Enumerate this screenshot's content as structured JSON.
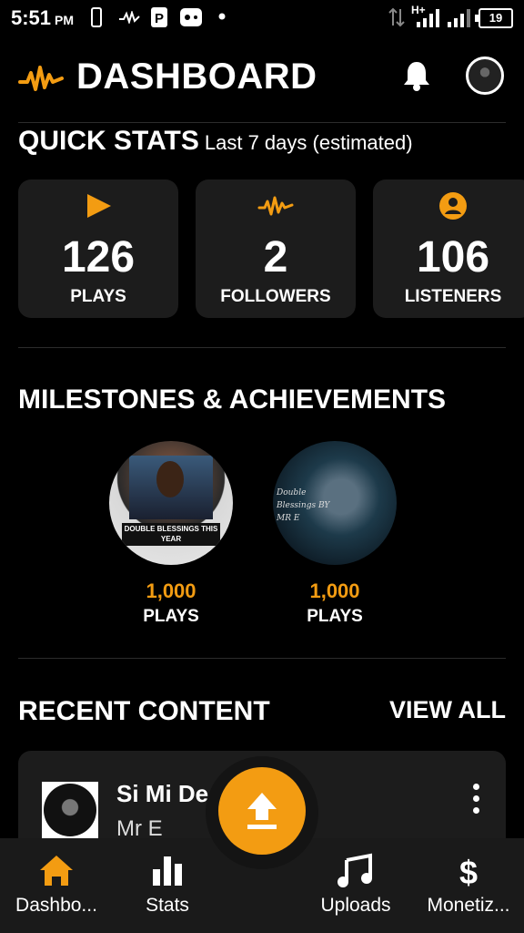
{
  "status_bar": {
    "time": "5:51",
    "ampm": "PM",
    "network": "H+",
    "battery": "19"
  },
  "header": {
    "title": "DASHBOARD"
  },
  "quick_stats": {
    "title": "QUICK STATS",
    "subtitle": "Last 7 days (estimated)",
    "cards": [
      {
        "value": "126",
        "label": "PLAYS",
        "icon": "play-icon"
      },
      {
        "value": "2",
        "label": "FOLLOWERS",
        "icon": "audiomack-logo-icon"
      },
      {
        "value": "106",
        "label": "LISTENERS",
        "icon": "user-circle-icon"
      }
    ]
  },
  "milestones": {
    "title": "MILESTONES & ACHIEVEMENTS",
    "items": [
      {
        "value": "1,000",
        "label": "PLAYS",
        "art_text": "DOUBLE BLESSINGS THIS YEAR"
      },
      {
        "value": "1,000",
        "label": "PLAYS",
        "art_text": "Double Blessings BY MR E"
      }
    ]
  },
  "recent_content": {
    "title": "RECENT CONTENT",
    "view_all": "VIEW ALL",
    "items": [
      {
        "title": "Si Mi De",
        "artist": "Mr E"
      }
    ]
  },
  "nav": [
    {
      "label": "Dashbo...",
      "icon": "home-icon",
      "active": true
    },
    {
      "label": "Stats",
      "icon": "bar-chart-icon",
      "active": false
    },
    {
      "label": "Uploads",
      "icon": "music-note-icon",
      "active": false
    },
    {
      "label": "Monetiz...",
      "icon": "dollar-icon",
      "active": false
    }
  ],
  "colors": {
    "accent": "#f39c12",
    "background": "#000000",
    "card": "#1c1c1c",
    "nav": "#1a1a1a"
  }
}
